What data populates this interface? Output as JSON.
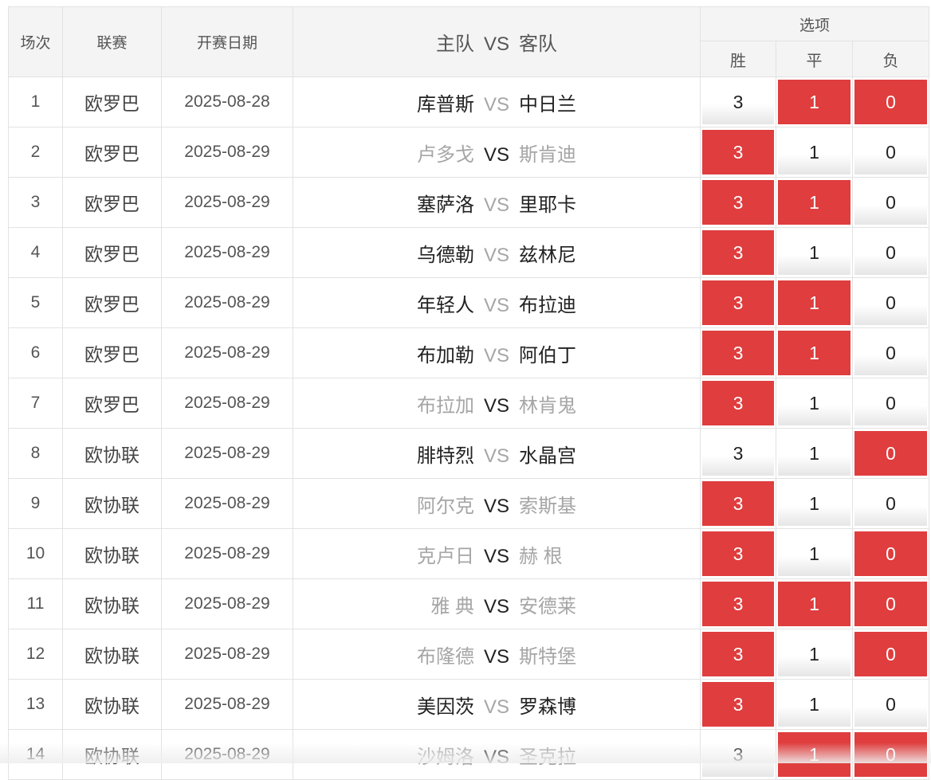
{
  "header": {
    "num": "场次",
    "league": "联赛",
    "date": "开赛日期",
    "match_home": "主队",
    "match_vs": "VS",
    "match_away": "客队",
    "options": "选项",
    "win": "胜",
    "draw": "平",
    "lose": "负"
  },
  "colors": {
    "selected": "#df3d3e",
    "dim_team": "#a6a6a6",
    "strong_team": "#222222"
  },
  "rows": [
    {
      "num": "1",
      "league": "欧罗巴",
      "date": "2025-08-28",
      "home": "库普斯",
      "vs": "VS",
      "away": "中日兰",
      "vs_dim": true,
      "home_dim": false,
      "away_dim": false,
      "win": "3",
      "draw": "1",
      "lose": "0",
      "sel": [
        false,
        true,
        true
      ]
    },
    {
      "num": "2",
      "league": "欧罗巴",
      "date": "2025-08-29",
      "home": "卢多戈",
      "vs": "VS",
      "away": "斯肯迪",
      "vs_dim": false,
      "home_dim": true,
      "away_dim": true,
      "win": "3",
      "draw": "1",
      "lose": "0",
      "sel": [
        true,
        false,
        false
      ]
    },
    {
      "num": "3",
      "league": "欧罗巴",
      "date": "2025-08-29",
      "home": "塞萨洛",
      "vs": "VS",
      "away": "里耶卡",
      "vs_dim": true,
      "home_dim": false,
      "away_dim": false,
      "win": "3",
      "draw": "1",
      "lose": "0",
      "sel": [
        true,
        true,
        false
      ]
    },
    {
      "num": "4",
      "league": "欧罗巴",
      "date": "2025-08-29",
      "home": "乌德勒",
      "vs": "VS",
      "away": "兹林尼",
      "vs_dim": true,
      "home_dim": false,
      "away_dim": false,
      "win": "3",
      "draw": "1",
      "lose": "0",
      "sel": [
        true,
        false,
        false
      ]
    },
    {
      "num": "5",
      "league": "欧罗巴",
      "date": "2025-08-29",
      "home": "年轻人",
      "vs": "VS",
      "away": "布拉迪",
      "vs_dim": true,
      "home_dim": false,
      "away_dim": false,
      "win": "3",
      "draw": "1",
      "lose": "0",
      "sel": [
        true,
        true,
        false
      ]
    },
    {
      "num": "6",
      "league": "欧罗巴",
      "date": "2025-08-29",
      "home": "布加勒",
      "vs": "VS",
      "away": "阿伯丁",
      "vs_dim": true,
      "home_dim": false,
      "away_dim": false,
      "win": "3",
      "draw": "1",
      "lose": "0",
      "sel": [
        true,
        true,
        false
      ]
    },
    {
      "num": "7",
      "league": "欧罗巴",
      "date": "2025-08-29",
      "home": "布拉加",
      "vs": "VS",
      "away": "林肯鬼",
      "vs_dim": false,
      "home_dim": true,
      "away_dim": true,
      "win": "3",
      "draw": "1",
      "lose": "0",
      "sel": [
        true,
        false,
        false
      ]
    },
    {
      "num": "8",
      "league": "欧协联",
      "date": "2025-08-29",
      "home": "腓特烈",
      "vs": "VS",
      "away": "水晶宫",
      "vs_dim": true,
      "home_dim": false,
      "away_dim": false,
      "win": "3",
      "draw": "1",
      "lose": "0",
      "sel": [
        false,
        false,
        true
      ]
    },
    {
      "num": "9",
      "league": "欧协联",
      "date": "2025-08-29",
      "home": "阿尔克",
      "vs": "VS",
      "away": "索斯基",
      "vs_dim": false,
      "home_dim": true,
      "away_dim": true,
      "win": "3",
      "draw": "1",
      "lose": "0",
      "sel": [
        true,
        false,
        false
      ]
    },
    {
      "num": "10",
      "league": "欧协联",
      "date": "2025-08-29",
      "home": "克卢日",
      "vs": "VS",
      "away": "赫 根",
      "vs_dim": false,
      "home_dim": true,
      "away_dim": true,
      "win": "3",
      "draw": "1",
      "lose": "0",
      "sel": [
        true,
        false,
        true
      ]
    },
    {
      "num": "11",
      "league": "欧协联",
      "date": "2025-08-29",
      "home": "雅 典",
      "vs": "VS",
      "away": "安德莱",
      "vs_dim": false,
      "home_dim": true,
      "away_dim": true,
      "win": "3",
      "draw": "1",
      "lose": "0",
      "sel": [
        true,
        true,
        true
      ]
    },
    {
      "num": "12",
      "league": "欧协联",
      "date": "2025-08-29",
      "home": "布隆德",
      "vs": "VS",
      "away": "斯特堡",
      "vs_dim": false,
      "home_dim": true,
      "away_dim": true,
      "win": "3",
      "draw": "1",
      "lose": "0",
      "sel": [
        true,
        false,
        true
      ]
    },
    {
      "num": "13",
      "league": "欧协联",
      "date": "2025-08-29",
      "home": "美因茨",
      "vs": "VS",
      "away": "罗森博",
      "vs_dim": true,
      "home_dim": false,
      "away_dim": false,
      "win": "3",
      "draw": "1",
      "lose": "0",
      "sel": [
        true,
        false,
        false
      ]
    },
    {
      "num": "14",
      "league": "欧协联",
      "date": "2025-08-29",
      "home": "沙姆洛",
      "vs": "VS",
      "away": "圣克拉",
      "vs_dim": false,
      "home_dim": true,
      "away_dim": true,
      "win": "3",
      "draw": "1",
      "lose": "0",
      "sel": [
        false,
        true,
        true
      ]
    }
  ]
}
